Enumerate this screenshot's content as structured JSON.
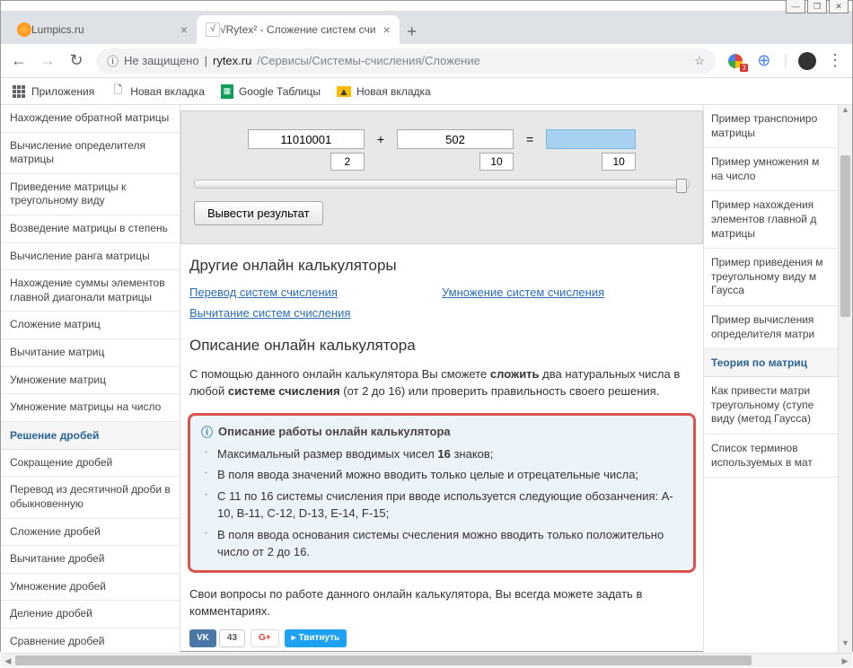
{
  "window": {
    "min": "—",
    "max": "❐",
    "close": "✕"
  },
  "tabs": [
    {
      "title": "Lumpics.ru",
      "active": false
    },
    {
      "title": "√Rytex² - Сложение систем счи",
      "active": true
    }
  ],
  "newtab": "+",
  "nav": {
    "back": "←",
    "forward": "→",
    "reload": "↻"
  },
  "omnibox": {
    "secure_icon": "ⓘ",
    "secure_label": "Не защищено",
    "sep": "|",
    "domain": "rytex.ru",
    "path": "/Сервисы/Системы-счисления/Сложение",
    "star": "☆"
  },
  "ext": {
    "badge": "3",
    "globe": "⊕",
    "divider": ""
  },
  "menu": "⋮",
  "bookmarks": [
    {
      "icon": "apps",
      "label": "Приложения"
    },
    {
      "icon": "doc",
      "label": "Новая вкладка"
    },
    {
      "icon": "sheets",
      "label": "Google Таблицы"
    },
    {
      "icon": "img",
      "label": "Новая вкладка"
    }
  ],
  "left_sidebar": {
    "items_top": [
      "Нахождение обратной матрицы",
      "Вычисление определителя матрицы",
      "Приведение матрицы к треугольному виду",
      "Возведение матрицы в степень",
      "Вычисление ранга матрицы",
      "Нахождение суммы элементов главной диагонали матрицы",
      "Сложение матриц",
      "Вычитание матриц",
      "Умножение матриц",
      "Умножение матрицы на число"
    ],
    "heading": "Решение дробей",
    "items_bottom": [
      "Сокращение дробей",
      "Перевод из десятичной дроби в обыкновенную",
      "Сложение дробей",
      "Вычитание дробей",
      "Умножение дробей",
      "Деление дробей",
      "Сравнение дробей"
    ]
  },
  "calc": {
    "in1": "11010001",
    "base1": "2",
    "op": "+",
    "in2": "502",
    "base2": "10",
    "eq": "=",
    "result": "",
    "base_out": "10",
    "button": "Вывести результат"
  },
  "h_other": "Другие онлайн калькуляторы",
  "links": {
    "l1": "Перевод систем счисления",
    "l2": "Вычитание систем счисления",
    "r1": "Умножение систем счисления"
  },
  "h_desc": "Описание онлайн калькулятора",
  "desc_p": {
    "pre": "С помощью данного онлайн калькулятора Вы сможете ",
    "b1": "сложить",
    "mid": " два натуральных числа в любой ",
    "b2": "системе счисления",
    "post": " (от 2 до 16) или проверить правильность своего решения."
  },
  "callout": {
    "title": "Описание работы онлайн калькулятора",
    "items": [
      {
        "pre": "Максимальный размер вводимых чисел ",
        "b": "16",
        "post": " знаков;"
      },
      {
        "pre": "В поля ввода значений можно вводить только целые и отрецательные числа;",
        "b": "",
        "post": ""
      },
      {
        "pre": "С 11 по 16 системы счисления при вводе используется следующие обозанчения: A-10, B-11, C-12, D-13, E-14, F-15;",
        "b": "",
        "post": ""
      },
      {
        "pre": "В поля ввода основания системы счесления можно вводить только положительно число от 2 до 16.",
        "b": "",
        "post": ""
      }
    ]
  },
  "questions_p": "Свои вопросы по работе данного онлайн калькулятора, Вы всегда можете задать в комментариях.",
  "social": {
    "vk": "VK",
    "vk_count": "43",
    "gp": "G+",
    "tw": "▸ Твитнуть"
  },
  "right_sidebar": {
    "items_top": [
      "Пример транспониро\nматрицы",
      "Пример умножения м\nна число",
      "Пример нахождения\nэлементов главной д\nматрицы",
      "Пример приведения м\nтреугольному виду м\nГаусса",
      "Пример вычисления\nопределителя матри"
    ],
    "heading": "Теория по матриц",
    "items_bottom": [
      "Как привести матри\nтреугольному (ступе\nвиду (метод Гаусса)",
      "Список терминов\nиспользуемых в мат"
    ]
  }
}
